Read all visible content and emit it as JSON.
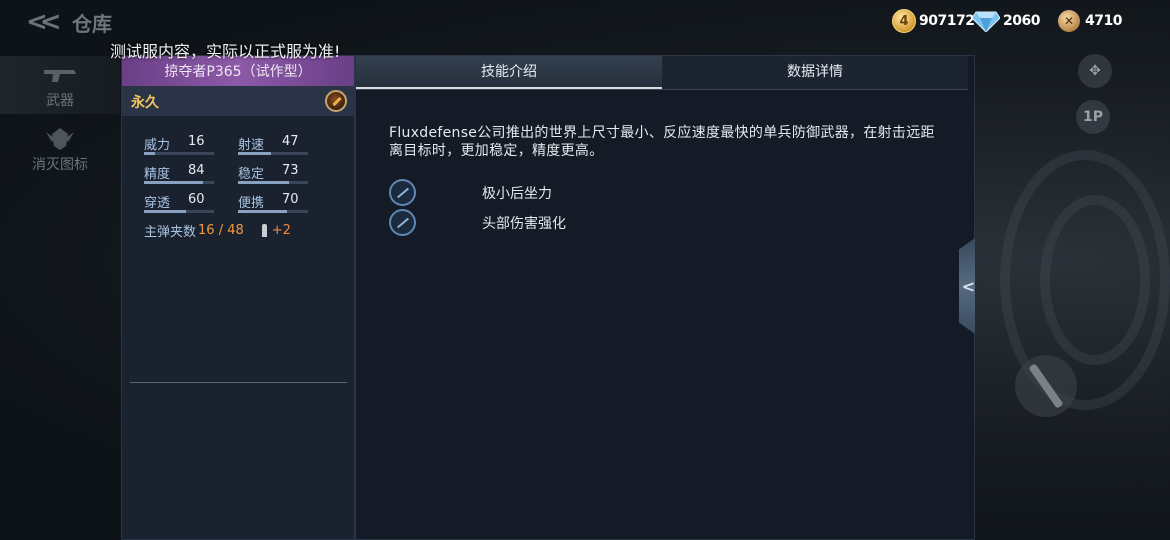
{
  "header": {
    "title": "仓库",
    "currencies": [
      {
        "icon": "gold-coin-icon",
        "value": "907172"
      },
      {
        "icon": "diamond-icon",
        "value": "2060"
      },
      {
        "icon": "token-icon",
        "value": "4710"
      }
    ]
  },
  "notice": "测试服内容，实际以正式服为准!",
  "sidebar": {
    "items": [
      {
        "label": "武器",
        "icon": "gun-icon"
      },
      {
        "label": "消灭图标",
        "icon": "emblem-icon"
      }
    ]
  },
  "right_controls": {
    "view_label": "1P"
  },
  "weapon": {
    "name": "掠夺者P365（试作型）",
    "durability": "永久",
    "stats": [
      {
        "label": "威力",
        "value": "16",
        "fill": 0.16
      },
      {
        "label": "射速",
        "value": "47",
        "fill": 0.47
      },
      {
        "label": "精度",
        "value": "84",
        "fill": 0.84
      },
      {
        "label": "稳定",
        "value": "73",
        "fill": 0.73
      },
      {
        "label": "穿透",
        "value": "60",
        "fill": 0.6
      },
      {
        "label": "便携",
        "value": "70",
        "fill": 0.7
      }
    ],
    "ammo_label": "主弹夹数",
    "ammo_value": "16 / 48",
    "ammo_bonus": "+2"
  },
  "tabs": [
    {
      "label": "技能介绍",
      "active": true
    },
    {
      "label": "数据详情",
      "active": false
    }
  ],
  "skills_tab": {
    "description": "Fluxdefense公司推出的世界上尺寸最小、反应速度最快的单兵防御武器，在射击远距离目标时，更加稳定，精度更高。",
    "skills": [
      {
        "name": "极小后坐力",
        "icon": "recoil-skill-icon"
      },
      {
        "name": "头部伤害强化",
        "icon": "headshot-skill-icon"
      }
    ]
  },
  "colors": {
    "accent_purple": "#8c5aa8",
    "durability_gold": "#f2c85c",
    "ammo_orange": "#f39a3c"
  }
}
